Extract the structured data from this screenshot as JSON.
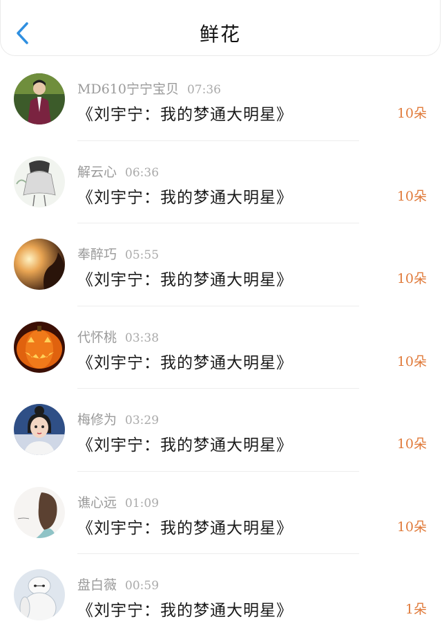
{
  "header": {
    "title": "鲜花",
    "back_icon": "chevron-left-icon",
    "accent": "#2f8fe0"
  },
  "count_color": "#e07a3a",
  "items": [
    {
      "user": "MD610宁宁宝贝",
      "time": "07:36",
      "book": "《刘宇宁：我的梦通大明星》",
      "count": "10朵",
      "avatar": "man-purple-suit"
    },
    {
      "user": "解云心",
      "time": "06:36",
      "book": "《刘宇宁：我的梦通大明星》",
      "count": "10朵",
      "avatar": "girl-sketch"
    },
    {
      "user": "奉醉巧",
      "time": "05:55",
      "book": "《刘宇宁：我的梦通大明星》",
      "count": "10朵",
      "avatar": "sunset-silhouette"
    },
    {
      "user": "代怀桃",
      "time": "03:38",
      "book": "《刘宇宁：我的梦通大明星》",
      "count": "10朵",
      "avatar": "jack-o-lantern"
    },
    {
      "user": "梅修为",
      "time": "03:29",
      "book": "《刘宇宁：我的梦通大明星》",
      "count": "10朵",
      "avatar": "cartoon-girl"
    },
    {
      "user": "谯心远",
      "time": "01:09",
      "book": "《刘宇宁：我的梦通大明星》",
      "count": "10朵",
      "avatar": "woman-hair"
    },
    {
      "user": "盘白薇",
      "time": "00:59",
      "book": "《刘宇宁：我的梦通大明星》",
      "count": "1朵",
      "avatar": "white-robot"
    }
  ]
}
